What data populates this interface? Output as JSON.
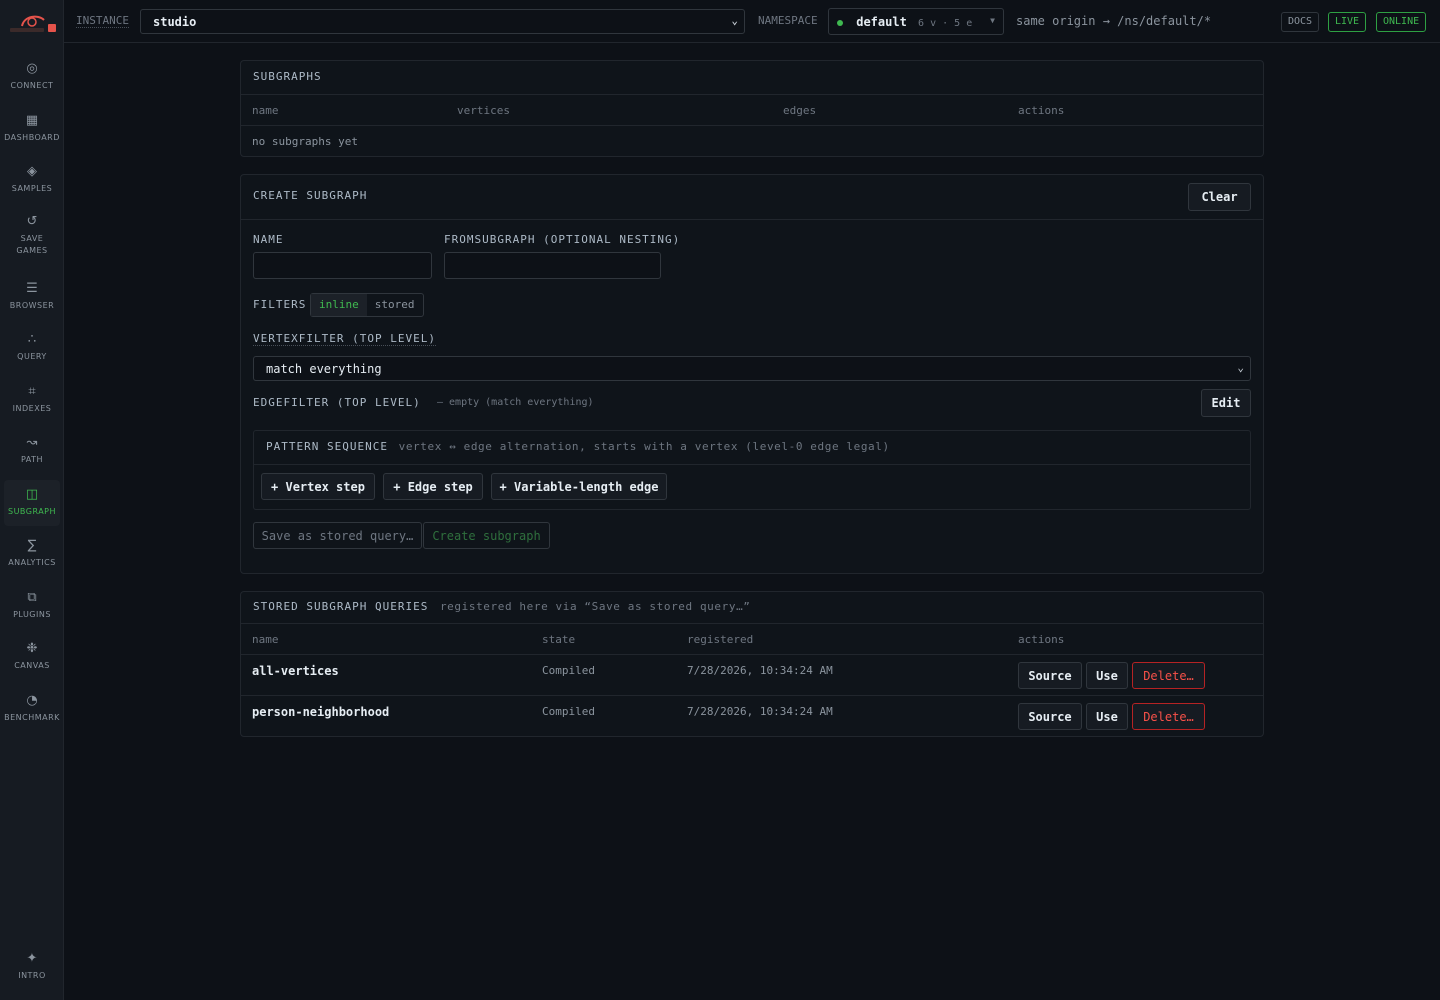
{
  "sidebar": {
    "items": [
      {
        "label": "CONNECT",
        "icon": "◎"
      },
      {
        "label": "DASHBOARD",
        "icon": "▦"
      },
      {
        "label": "SAMPLES",
        "icon": "◈"
      },
      {
        "label": "SAVE\nGAMES",
        "icon": "↺"
      },
      {
        "label": "BROWSER",
        "icon": "☰"
      },
      {
        "label": "QUERY",
        "icon": "∴"
      },
      {
        "label": "INDEXES",
        "icon": "⌗"
      },
      {
        "label": "PATH",
        "icon": "↝"
      },
      {
        "label": "SUBGRAPH",
        "icon": "◫"
      },
      {
        "label": "ANALYTICS",
        "icon": "∑"
      },
      {
        "label": "PLUGINS",
        "icon": "⧉"
      },
      {
        "label": "CANVAS",
        "icon": "❉"
      },
      {
        "label": "BENCHMARK",
        "icon": "◔"
      }
    ],
    "intro": {
      "label": "INTRO",
      "icon": "✦"
    }
  },
  "topbar": {
    "instance_label": "INSTANCE",
    "instance_value": "studio",
    "namespace_label": "NAMESPACE",
    "namespace_value": "default",
    "namespace_counts": "6 v · 5 e",
    "origin": "same origin → /ns/default/*",
    "docs": "DOCS",
    "live": "LIVE",
    "online": "ONLINE"
  },
  "subgraphs": {
    "title": "SUBGRAPHS",
    "columns": [
      "name",
      "vertices",
      "edges",
      "actions"
    ],
    "empty": "no subgraphs yet"
  },
  "create": {
    "title": "CREATE SUBGRAPH",
    "clear": "Clear",
    "name_label": "NAME",
    "from_label": "FROMSUBGRAPH (OPTIONAL NESTING)",
    "filters_label": "FILTERS",
    "filter_inline": "inline",
    "filter_stored": "stored",
    "vertexfilter_label": "VERTEXFILTER (TOP LEVEL)",
    "vertexfilter_value": "match everything",
    "edgefilter_label": "EDGEFILTER (TOP LEVEL)",
    "edgefilter_hint": "— empty (match everything)",
    "edit": "Edit",
    "pattern_title": "PATTERN SEQUENCE",
    "pattern_hint": "vertex ↔ edge alternation, starts with a vertex (level-0 edge legal)",
    "add_vertex": "+ Vertex step",
    "add_edge": "+ Edge step",
    "add_varlen": "+ Variable-length edge",
    "save_stored": "Save as stored query…",
    "create_btn": "Create subgraph"
  },
  "stored": {
    "title": "STORED SUBGRAPH QUERIES",
    "subtitle": "registered here via “Save as stored query…”",
    "columns": [
      "name",
      "state",
      "registered",
      "actions"
    ],
    "rows": [
      {
        "name": "all-vertices",
        "state": "Compiled",
        "registered": "7/28/2026, 10:34:24 AM"
      },
      {
        "name": "person-neighborhood",
        "state": "Compiled",
        "registered": "7/28/2026, 10:34:24 AM"
      }
    ],
    "source": "Source",
    "use": "Use",
    "delete": "Delete…"
  },
  "colors": {
    "accent": "#3fb950",
    "danger": "#f85149",
    "bg": "#0d1117"
  }
}
